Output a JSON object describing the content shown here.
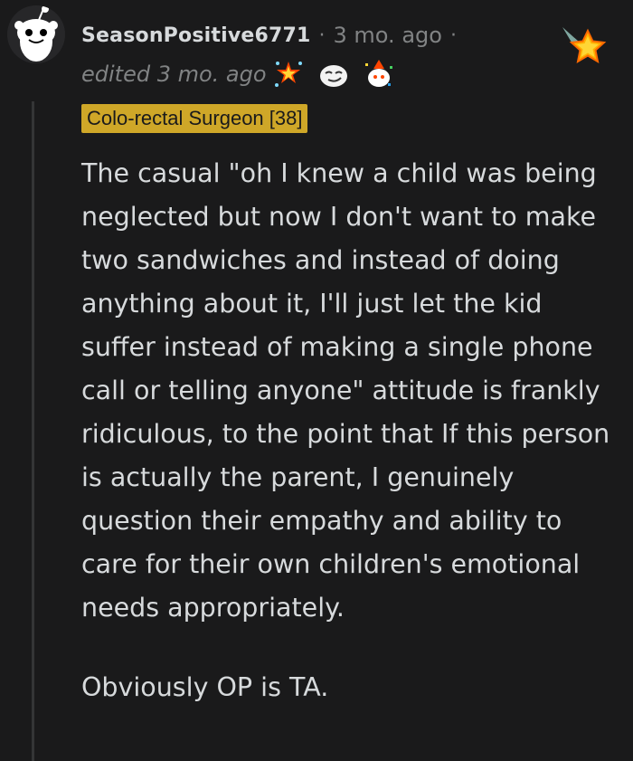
{
  "comment": {
    "username": "SeasonPositive6771",
    "separator": "·",
    "timestamp": "3 mo. ago",
    "edited": "edited 3 mo. ago",
    "flair": "Colo-rectal Surgeon [38]",
    "awards": [
      "starstruck-award-icon",
      "smirk-face-award-icon",
      "party-snoo-award-icon",
      "rising-star-award-icon"
    ],
    "paragraphs": [
      "The casual \"oh I knew a child was being neglected but now I don't want to make two sandwiches and instead of doing anything about it, I'll just let the kid suffer instead of making a single phone call or telling anyone\" attitude is frankly ridiculous, to the point that If this person is actually the parent, I genuinely question their empathy and ability to care for their own children's emotional needs appropriately.",
      "Obviously OP is TA."
    ]
  },
  "colors": {
    "background": "#1a1a1b",
    "text": "#d7dadc",
    "meta": "#818384",
    "flair_bg": "#cfa728",
    "thread_line": "#343536"
  }
}
